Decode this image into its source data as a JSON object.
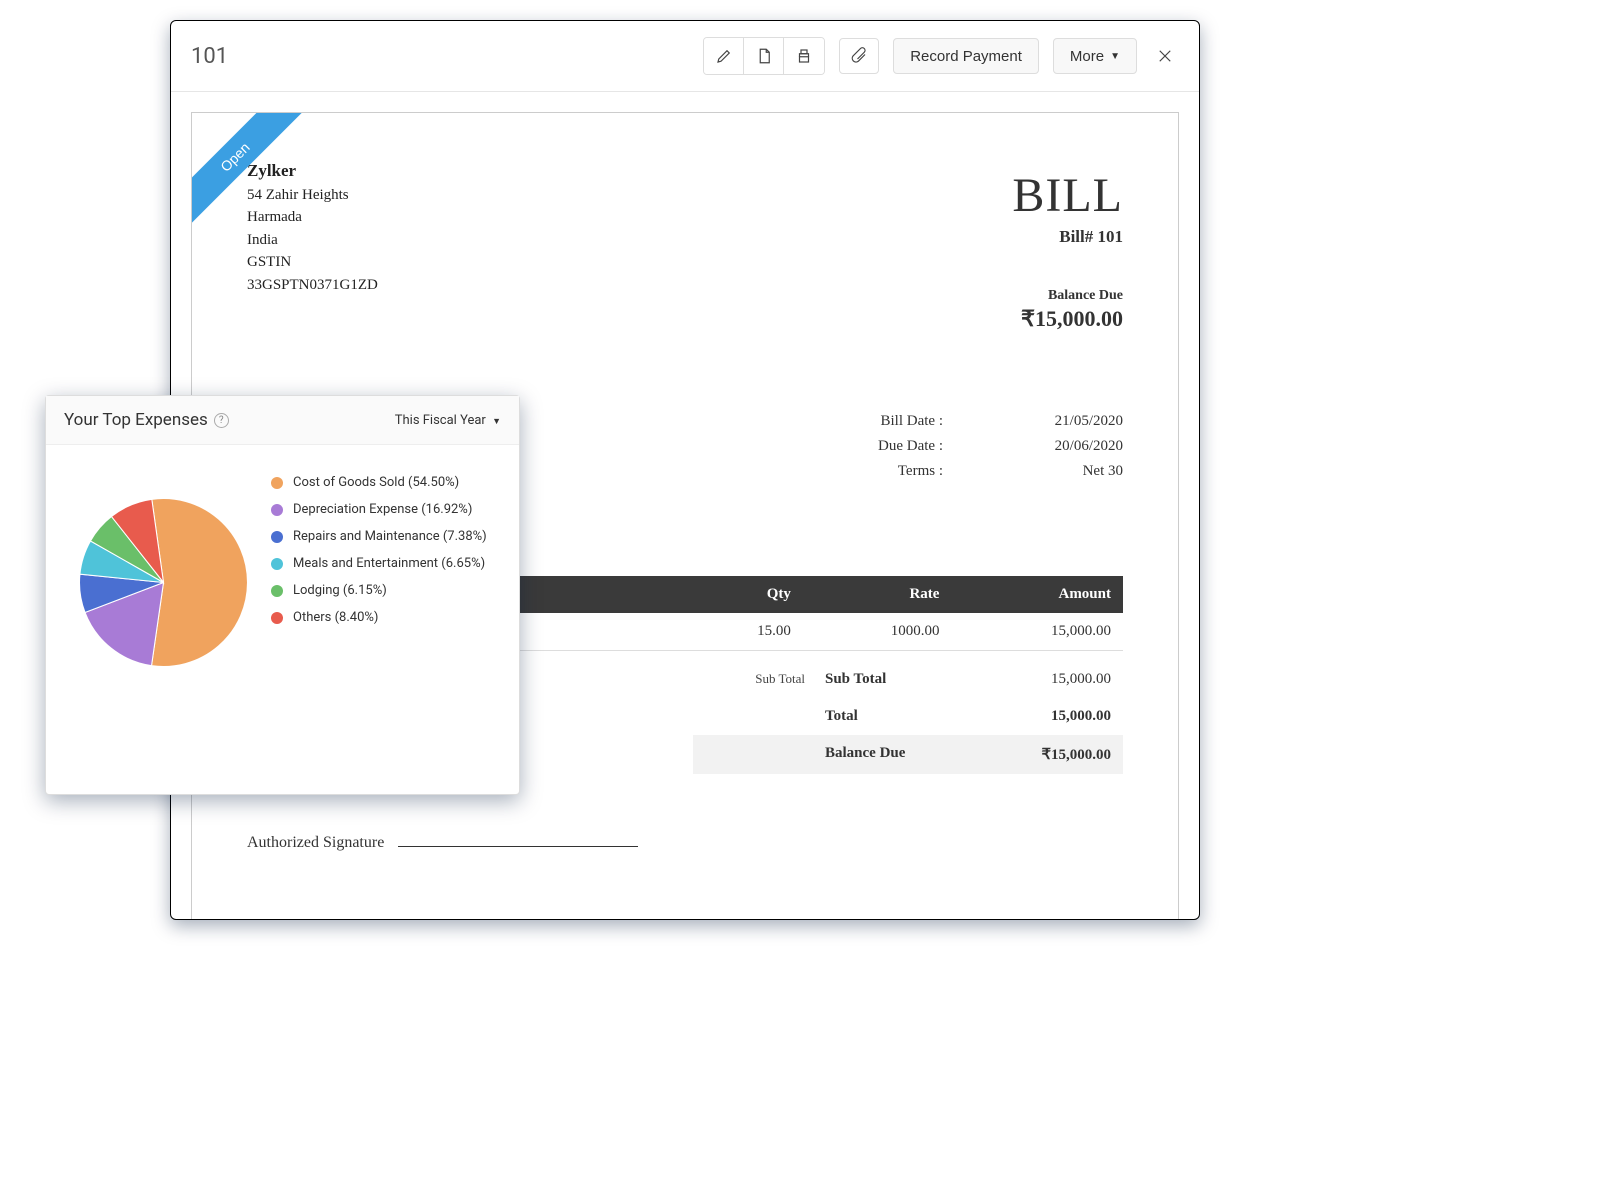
{
  "toolbar": {
    "title": "101",
    "record_payment": "Record Payment",
    "more": "More"
  },
  "ribbon": {
    "status": "Open"
  },
  "company": {
    "name": "Zylker",
    "line1": "54 Zahir Heights",
    "line2": "Harmada",
    "country": "India",
    "gstin_label": "GSTIN",
    "gstin": "33GSPTN0371G1ZD"
  },
  "bill": {
    "heading": "BILL",
    "number_label": "Bill# 101",
    "balance_label": "Balance Due",
    "balance_amount": "₹15,000.00",
    "meta": {
      "bill_date_label": "Bill Date :",
      "bill_date": "21/05/2020",
      "due_date_label": "Due Date :",
      "due_date": "20/06/2020",
      "terms_label": "Terms :",
      "terms": "Net 30"
    },
    "table_headers": {
      "item": "",
      "qty": "Qty",
      "rate": "Rate",
      "amount": "Amount"
    },
    "rows": [
      {
        "item": "",
        "qty": "15.00",
        "rate": "1000.00",
        "amount": "15,000.00"
      }
    ],
    "totals": {
      "sub_hint": "Sub Total",
      "sub_label": "Sub Total",
      "sub_value": "15,000.00",
      "total_label": "Total",
      "total_value": "15,000.00",
      "balance_label": "Balance Due",
      "balance_value": "₹15,000.00"
    },
    "signature_label": "Authorized Signature"
  },
  "expenses": {
    "title": "Your Top Expenses",
    "period": "This Fiscal Year",
    "items": [
      {
        "label": "Cost of Goods Sold (54.50%)",
        "color": "#f0a35e"
      },
      {
        "label": "Depreciation Expense (16.92%)",
        "color": "#a87bd6"
      },
      {
        "label": "Repairs and Maintenance (7.38%)",
        "color": "#4a6fd1"
      },
      {
        "label": "Meals and Entertainment (6.65%)",
        "color": "#4fc3d9"
      },
      {
        "label": "Lodging (6.15%)",
        "color": "#6abf69"
      },
      {
        "label": "Others (8.40%)",
        "color": "#e85b4d"
      }
    ]
  },
  "chart_data": {
    "type": "pie",
    "title": "Your Top Expenses",
    "categories": [
      "Cost of Goods Sold",
      "Depreciation Expense",
      "Repairs and Maintenance",
      "Meals and Entertainment",
      "Lodging",
      "Others"
    ],
    "values": [
      54.5,
      16.92,
      7.38,
      6.65,
      6.15,
      8.4
    ],
    "colors": [
      "#f0a35e",
      "#a87bd6",
      "#4a6fd1",
      "#4fc3d9",
      "#6abf69",
      "#e85b4d"
    ],
    "unit": "percent"
  }
}
